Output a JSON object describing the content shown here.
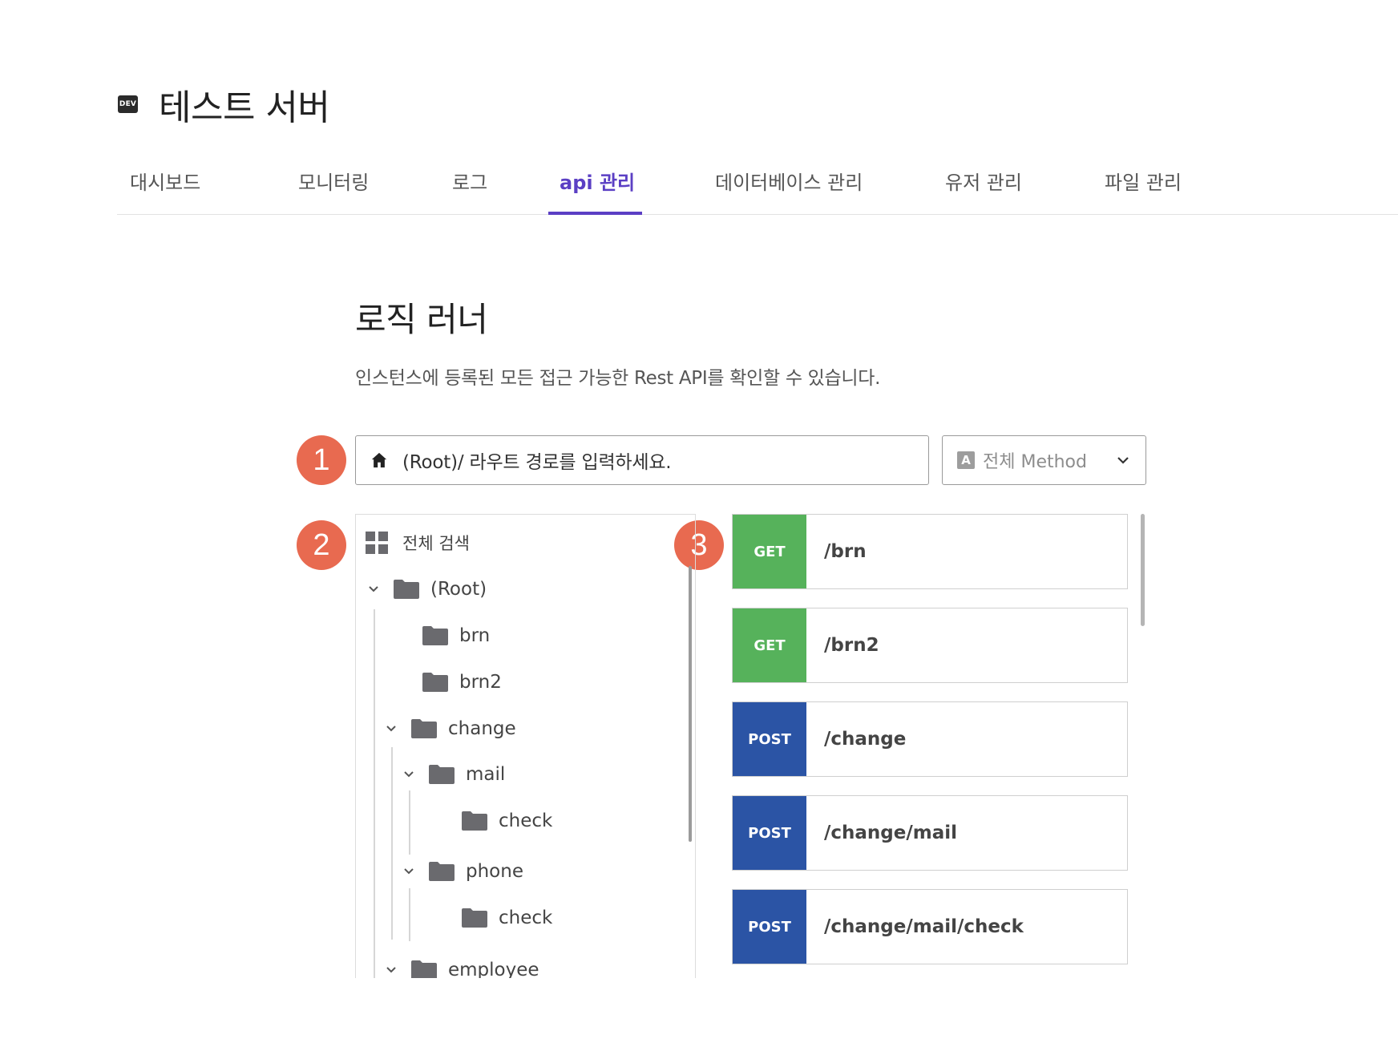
{
  "header": {
    "badge": "DEV",
    "title": "테스트 서버"
  },
  "tabs": [
    {
      "label": "대시보드",
      "active": false
    },
    {
      "label": "모니터링",
      "active": false
    },
    {
      "label": "로그",
      "active": false
    },
    {
      "label": "api 관리",
      "active": true
    },
    {
      "label": "데이터베이스 관리",
      "active": false
    },
    {
      "label": "유저 관리",
      "active": false
    },
    {
      "label": "파일 관리",
      "active": false
    }
  ],
  "section": {
    "title": "로직 러너",
    "description": "인스턴스에 등록된 모든 접근 가능한 Rest API를 확인할 수 있습니다."
  },
  "markers": [
    "1",
    "2",
    "3"
  ],
  "route_input": {
    "icon": "home-icon",
    "value": "(Root)/ 라우트 경로를 입력하세요."
  },
  "method_select": {
    "icon_letter": "A",
    "selected": "전체 Method"
  },
  "tree": {
    "all_label": "전체 검색",
    "items": [
      {
        "label": "(Root)",
        "expanded": true
      },
      {
        "label": "brn"
      },
      {
        "label": "brn2"
      },
      {
        "label": "change",
        "expanded": true
      },
      {
        "label": "mail",
        "expanded": true
      },
      {
        "label": "check"
      },
      {
        "label": "phone",
        "expanded": true
      },
      {
        "label": "check"
      },
      {
        "label": "employee",
        "expanded": true
      }
    ]
  },
  "endpoints": [
    {
      "method": "GET",
      "path": "/brn"
    },
    {
      "method": "GET",
      "path": "/brn2"
    },
    {
      "method": "POST",
      "path": "/change"
    },
    {
      "method": "POST",
      "path": "/change/mail"
    },
    {
      "method": "POST",
      "path": "/change/mail/check"
    }
  ],
  "colors": {
    "accent": "#5b3fc4",
    "marker": "#e86a50",
    "get": "#56b25b",
    "post": "#2b54a5"
  }
}
